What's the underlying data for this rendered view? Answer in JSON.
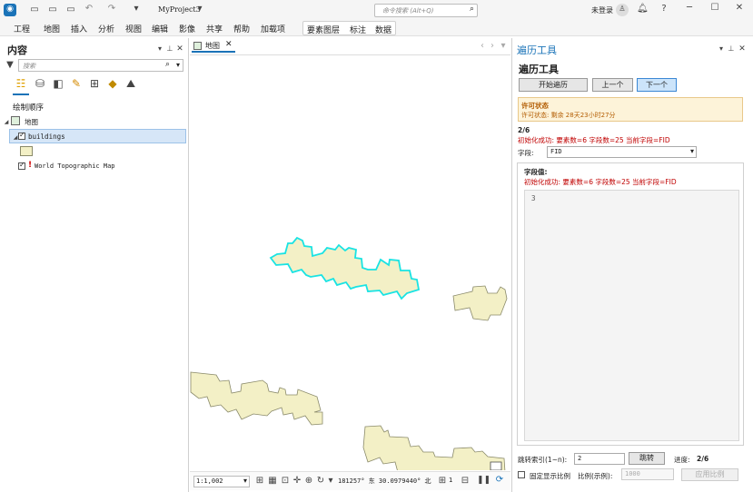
{
  "titlebar": {
    "project": "MyProject3",
    "search_placeholder": "命令搜索 (Alt+Q)",
    "user": "未登录",
    "help": "?"
  },
  "ribbon": {
    "tabs": [
      "工程",
      "地图",
      "插入",
      "分析",
      "视图",
      "编辑",
      "影像",
      "共享",
      "帮助",
      "加载项"
    ],
    "context_tabs": [
      "要素图层",
      "标注",
      "数据"
    ]
  },
  "contents": {
    "title": "内容",
    "search_placeholder": "搜索",
    "draw_order": "绘制顺序",
    "map": "地图",
    "layer1": "buildings",
    "layer2": "World Topographic Map",
    "layer2_badge": "!"
  },
  "mapview": {
    "tab": "地图",
    "scale": "1:1,002",
    "coords": "181257° 东 30.0979440° 北",
    "selected": "1"
  },
  "tool": {
    "pane_title": "遍历工具",
    "heading": "遍历工具",
    "btn_start": "开始遍历",
    "btn_prev": "上一个",
    "btn_next": "下一个",
    "license_title": "许可状态",
    "license_text": "许可状态: 剩余 28天23小时27分",
    "progress": "2/6",
    "init_msg": "初始化成功: 要素数=6 字段数=25 当前字段=FID",
    "field_label": "字段:",
    "field_value": "FID",
    "fieldvals_label": "字段值:",
    "fieldvals_msg": "初始化成功: 要素数=6 字段数=25 当前字段=FID",
    "value": "3",
    "jump_label": "跳转索引(1~n):",
    "jump_value": "2",
    "jump_btn": "跳转",
    "progress_label": "进度:",
    "progress_value": "2/6",
    "fixed_scale": "固定显示比例",
    "scale_label": "比例(示例):",
    "scale_placeholder": "1000",
    "apply_btn": "应用比例"
  },
  "colors": {
    "accent": "#1a73b8",
    "building_fill": "#f3f0c6",
    "building_stroke": "#8a8a6a",
    "selection": "#19e3e3",
    "error": "#c00000"
  }
}
